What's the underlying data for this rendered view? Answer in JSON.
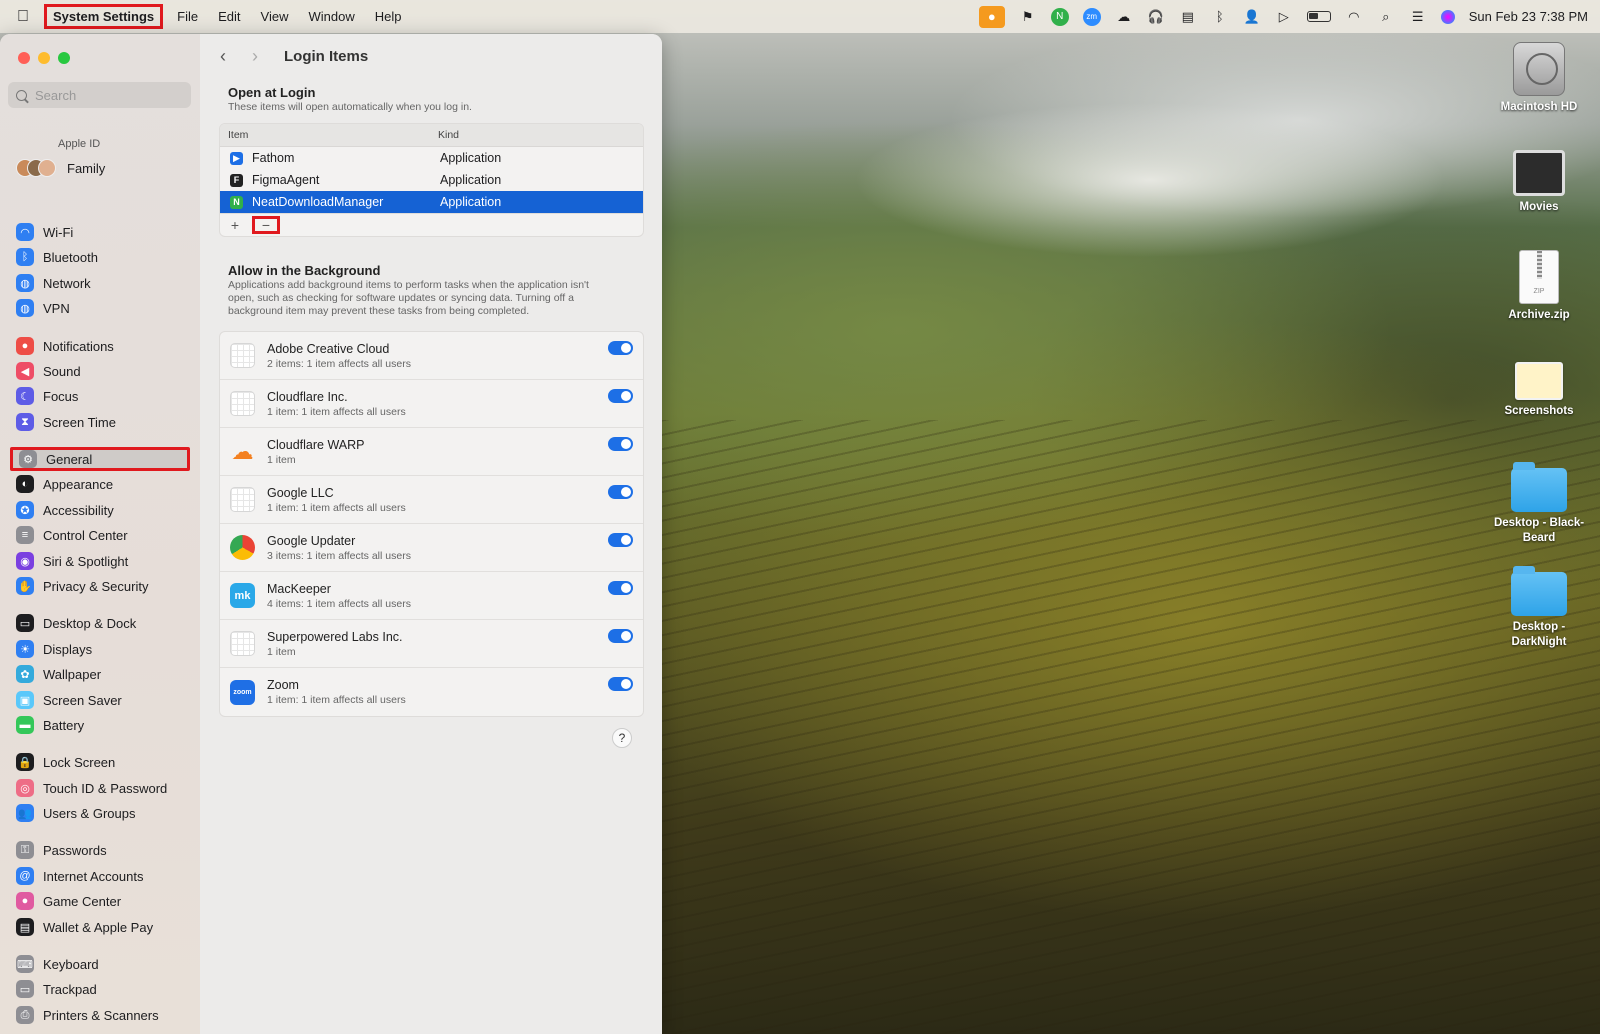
{
  "menubar": {
    "app_name": "System Settings",
    "menus": [
      "File",
      "Edit",
      "View",
      "Window",
      "Help"
    ],
    "datetime": "Sun Feb 23  7:38 PM",
    "status_icons": [
      "microphone-icon",
      "flag-icon",
      "ndm-icon",
      "zoom-icon",
      "cloud-icon",
      "headphones-icon",
      "display-icon",
      "bluetooth-icon",
      "user-icon",
      "play-icon",
      "battery-icon",
      "wifi-icon",
      "search-icon",
      "control-center-icon",
      "siri-icon"
    ]
  },
  "sidebar": {
    "search_placeholder": "Search",
    "apple_id_label": "Apple ID",
    "family_label": "Family",
    "items": [
      {
        "label": "Wi-Fi",
        "icon": "wifi-icon",
        "color": "#2f7ff2"
      },
      {
        "label": "Bluetooth",
        "icon": "bluetooth-icon",
        "color": "#2f7ff2"
      },
      {
        "label": "Network",
        "icon": "globe-icon",
        "color": "#2f7ff2"
      },
      {
        "label": "VPN",
        "icon": "vpn-icon",
        "color": "#2f7ff2"
      },
      {
        "label": "Notifications",
        "icon": "bell-icon",
        "color": "#ee4d46"
      },
      {
        "label": "Sound",
        "icon": "speaker-icon",
        "color": "#ee4d66"
      },
      {
        "label": "Focus",
        "icon": "moon-icon",
        "color": "#5e5ce6"
      },
      {
        "label": "Screen Time",
        "icon": "hourglass-icon",
        "color": "#5e5ce6"
      },
      {
        "label": "General",
        "icon": "gear-icon",
        "color": "#8e8e93"
      },
      {
        "label": "Appearance",
        "icon": "appearance-icon",
        "color": "#1d1d1f"
      },
      {
        "label": "Accessibility",
        "icon": "accessibility-icon",
        "color": "#2f7ff2"
      },
      {
        "label": "Control Center",
        "icon": "switches-icon",
        "color": "#8e8e93"
      },
      {
        "label": "Siri & Spotlight",
        "icon": "siri-icon",
        "color": "#7a3fe0"
      },
      {
        "label": "Privacy & Security",
        "icon": "hand-icon",
        "color": "#2f7ff2"
      },
      {
        "label": "Desktop & Dock",
        "icon": "dock-icon",
        "color": "#1d1d1f"
      },
      {
        "label": "Displays",
        "icon": "sun-icon",
        "color": "#2f7ff2"
      },
      {
        "label": "Wallpaper",
        "icon": "flower-icon",
        "color": "#34aadc"
      },
      {
        "label": "Screen Saver",
        "icon": "screensaver-icon",
        "color": "#5ac8fa"
      },
      {
        "label": "Battery",
        "icon": "battery-icon",
        "color": "#34c759"
      },
      {
        "label": "Lock Screen",
        "icon": "lock-icon",
        "color": "#1d1d1f"
      },
      {
        "label": "Touch ID & Password",
        "icon": "fingerprint-icon",
        "color": "#ee6d86"
      },
      {
        "label": "Users & Groups",
        "icon": "users-icon",
        "color": "#2f7ff2"
      },
      {
        "label": "Passwords",
        "icon": "key-icon",
        "color": "#8e8e93"
      },
      {
        "label": "Internet Accounts",
        "icon": "at-icon",
        "color": "#2f7ff2"
      },
      {
        "label": "Game Center",
        "icon": "gamecenter-icon",
        "color": "#e05aa0"
      },
      {
        "label": "Wallet & Apple Pay",
        "icon": "wallet-icon",
        "color": "#1d1d1f"
      },
      {
        "label": "Keyboard",
        "icon": "keyboard-icon",
        "color": "#8e8e93"
      },
      {
        "label": "Trackpad",
        "icon": "trackpad-icon",
        "color": "#8e8e93"
      },
      {
        "label": "Printers & Scanners",
        "icon": "printer-icon",
        "color": "#8e8e93"
      }
    ],
    "selected": "General"
  },
  "content": {
    "title": "Login Items",
    "open_at_login": {
      "title": "Open at Login",
      "subtitle": "These items will open automatically when you log in.",
      "columns": [
        "Item",
        "Kind"
      ],
      "rows": [
        {
          "name": "Fathom",
          "kind": "Application",
          "icon_color": "#1d6fe6",
          "glyph": "▶"
        },
        {
          "name": "FigmaAgent",
          "kind": "Application",
          "icon_color": "#222222",
          "glyph": "F"
        },
        {
          "name": "NeatDownloadManager",
          "kind": "Application",
          "icon_color": "#31b04a",
          "glyph": "N"
        }
      ],
      "selected_row": "NeatDownloadManager",
      "add_label": "+",
      "remove_label": "−"
    },
    "background": {
      "title": "Allow in the Background",
      "subtitle": "Applications add background items to perform tasks when the application isn't open, such as checking for software updates or syncing data. Turning off a background item may prevent these tasks from being completed.",
      "items": [
        {
          "name": "Adobe Creative Cloud",
          "desc": "2 items: 1 item affects all users",
          "icon": "generic-app-icon",
          "enabled": true
        },
        {
          "name": "Cloudflare Inc.",
          "desc": "1 item: 1 item affects all users",
          "icon": "generic-app-icon",
          "enabled": true
        },
        {
          "name": "Cloudflare WARP",
          "desc": "1 item",
          "icon": "cloudflare-icon",
          "enabled": true
        },
        {
          "name": "Google LLC",
          "desc": "1 item: 1 item affects all users",
          "icon": "generic-app-icon",
          "enabled": true
        },
        {
          "name": "Google Updater",
          "desc": "3 items: 1 item affects all users",
          "icon": "chrome-icon",
          "enabled": true
        },
        {
          "name": "MacKeeper",
          "desc": "4 items: 1 item affects all users",
          "icon": "mackeeper-icon",
          "enabled": true
        },
        {
          "name": "Superpowered Labs Inc.",
          "desc": "1 item",
          "icon": "generic-app-icon",
          "enabled": true
        },
        {
          "name": "Zoom",
          "desc": "1 item: 1 item affects all users",
          "icon": "zoom-icon",
          "enabled": true
        }
      ]
    },
    "help_label": "?"
  },
  "desktop": {
    "icons": [
      {
        "label": "Macintosh HD",
        "type": "hard-drive-icon"
      },
      {
        "label": "Movies",
        "type": "movies-icon"
      },
      {
        "label": "Archive.zip",
        "type": "zip-icon",
        "badge": "ZIP"
      },
      {
        "label": "Screenshots",
        "type": "screenshots-icon"
      },
      {
        "label": "Desktop - Black-Beard",
        "type": "folder-icon"
      },
      {
        "label": "Desktop - DarkNight",
        "type": "folder-icon"
      }
    ]
  },
  "colors": {
    "accent": "#1562d4",
    "toggle_on": "#1d6fe6",
    "highlight_box": "#e0191e"
  }
}
